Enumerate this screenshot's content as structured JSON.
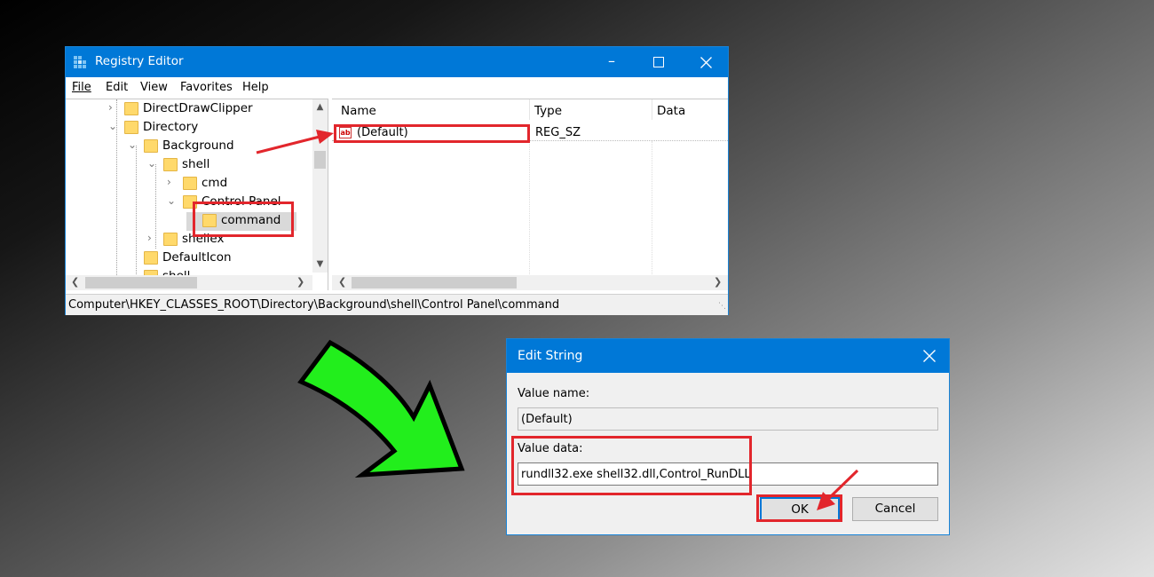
{
  "registry": {
    "title": "Registry Editor",
    "menu": [
      "File",
      "Edit",
      "View",
      "Favorites",
      "Help"
    ],
    "tree": [
      {
        "label": "DirectDrawClipper",
        "level": 0,
        "expander": "›"
      },
      {
        "label": "Directory",
        "level": 0,
        "expander": "⌄"
      },
      {
        "label": "Background",
        "level": 1,
        "expander": "⌄"
      },
      {
        "label": "shell",
        "level": 2,
        "expander": "⌄"
      },
      {
        "label": "cmd",
        "level": 3,
        "expander": "›"
      },
      {
        "label": "Control Panel",
        "level": 3,
        "expander": "⌄"
      },
      {
        "label": "command",
        "level": 4,
        "expander": ""
      },
      {
        "label": "shellex",
        "level": 2,
        "expander": "›"
      },
      {
        "label": "DefaultIcon",
        "level": 1,
        "expander": ""
      },
      {
        "label": "shell",
        "level": 1,
        "expander": ""
      }
    ],
    "columns": {
      "name": "Name",
      "type": "Type",
      "data": "Data"
    },
    "value_row": {
      "name": "(Default)",
      "type": "REG_SZ",
      "icon": "ab"
    },
    "status_path": "Computer\\HKEY_CLASSES_ROOT\\Directory\\Background\\shell\\Control Panel\\command"
  },
  "dialog": {
    "title": "Edit String",
    "value_name_label": "Value name:",
    "value_name": "(Default)",
    "value_data_label": "Value data:",
    "value_data": "rundll32.exe shell32.dll,Control_RunDLL",
    "ok_label": "OK",
    "cancel_label": "Cancel"
  },
  "colors": {
    "accent": "#0078d7",
    "highlight": "#e2262c",
    "arrow": "#22ee1c"
  }
}
